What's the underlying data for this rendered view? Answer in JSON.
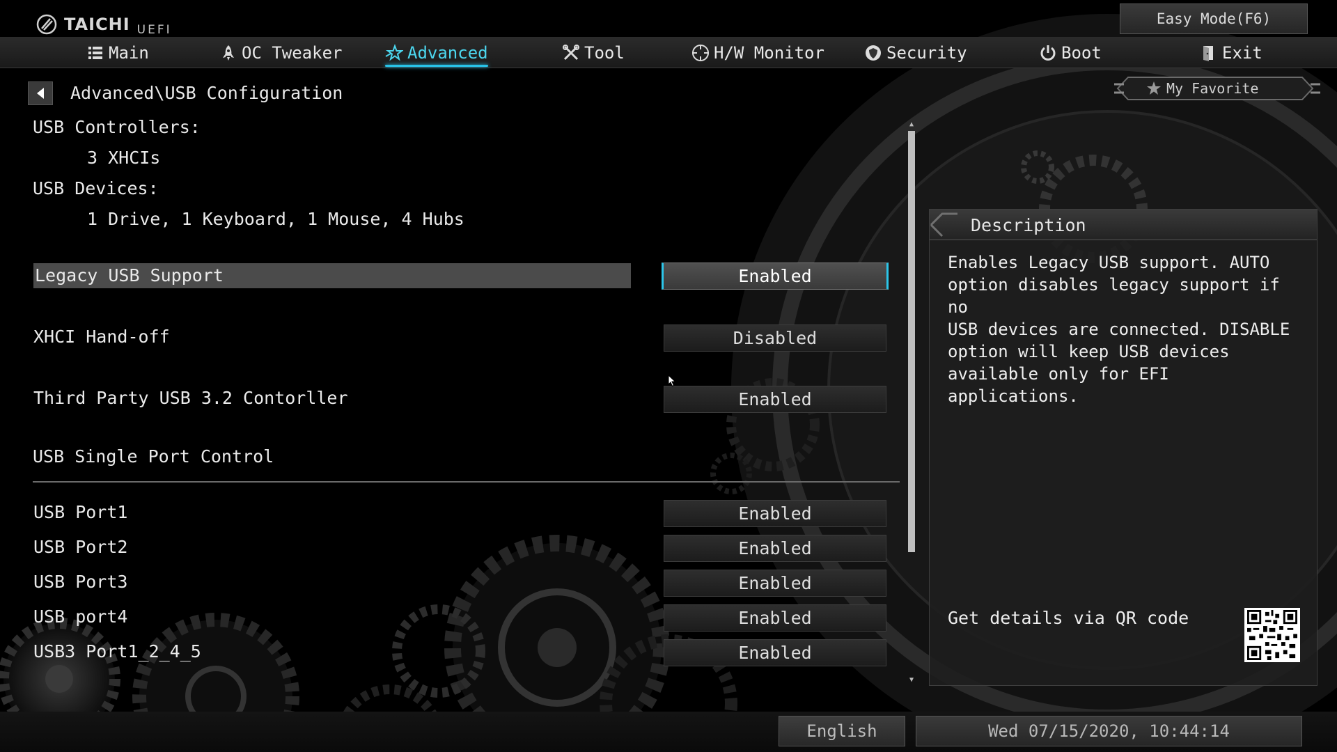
{
  "header": {
    "brand_name": "TAICHI",
    "brand_sub": "UEFI",
    "easy_mode_label": "Easy Mode(F6)"
  },
  "nav": {
    "items": [
      {
        "label": "Main",
        "icon": "list-icon"
      },
      {
        "label": "OC Tweaker",
        "icon": "rocket-icon"
      },
      {
        "label": "Advanced",
        "icon": "star-icon",
        "active": true
      },
      {
        "label": "Tool",
        "icon": "tools-icon"
      },
      {
        "label": "H/W Monitor",
        "icon": "crosshair-icon"
      },
      {
        "label": "Security",
        "icon": "shield-icon"
      },
      {
        "label": "Boot",
        "icon": "power-icon"
      },
      {
        "label": "Exit",
        "icon": "exit-door-icon"
      }
    ]
  },
  "breadcrumb": "Advanced\\USB Configuration",
  "my_favorite_label": "My Favorite",
  "info": {
    "controllers_label": "USB Controllers:",
    "controllers_value": "3 XHCIs",
    "devices_label": "USB Devices:",
    "devices_value": "1 Drive, 1 Keyboard, 1 Mouse, 4 Hubs"
  },
  "settings": [
    {
      "label": "Legacy USB Support",
      "value": "Enabled",
      "selected": true
    },
    {
      "label": "XHCI Hand-off",
      "value": "Disabled"
    },
    {
      "label": "Third Party USB 3.2 Contorller",
      "value": "Enabled"
    }
  ],
  "port_section": {
    "title": "USB Single Port Control",
    "ports": [
      {
        "label": "USB Port1",
        "value": "Enabled"
      },
      {
        "label": "USB Port2",
        "value": "Enabled"
      },
      {
        "label": "USB Port3",
        "value": "Enabled"
      },
      {
        "label": "USB port4",
        "value": "Enabled"
      },
      {
        "label": "USB3 Port1_2_4_5",
        "value": "Enabled"
      }
    ]
  },
  "description": {
    "title": "Description",
    "body": "Enables Legacy USB support. AUTO\noption disables legacy support if no\nUSB devices are connected. DISABLE\noption will keep USB devices\navailable only for EFI applications.",
    "qr_text": "Get details via QR code"
  },
  "footer": {
    "language": "English",
    "datetime": "Wed 07/15/2020, 10:44:14"
  },
  "colors": {
    "accent": "#28c3e8",
    "highlight_row": "#4b4b4b",
    "background": "#000000"
  }
}
